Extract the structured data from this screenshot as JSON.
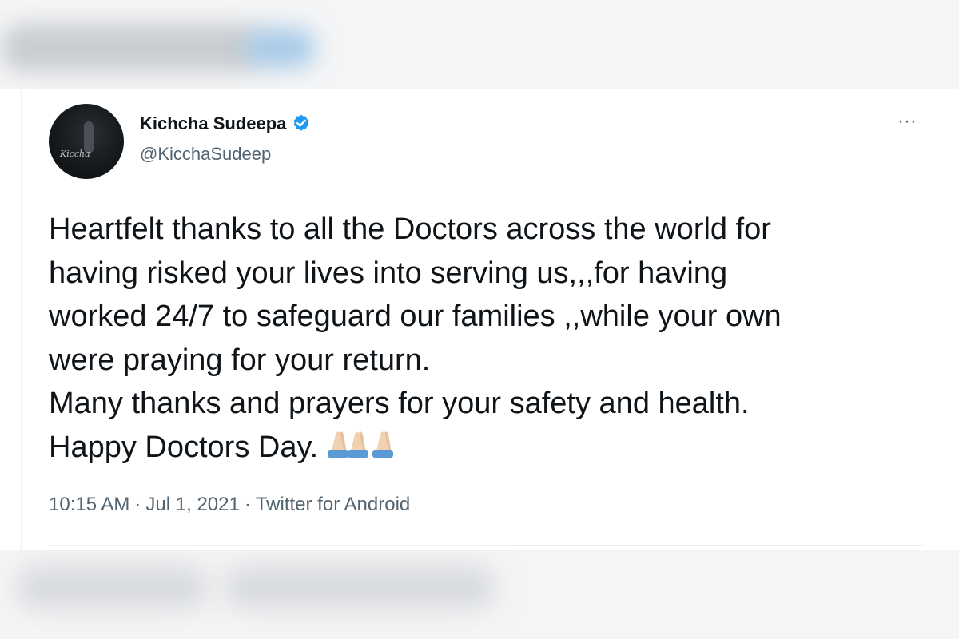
{
  "tweet": {
    "author": {
      "display_name": "Kichcha Sudeepa",
      "handle": "@KicchaSudeep",
      "verified": true,
      "avatar_signature": "Kiccha"
    },
    "more_label": "···",
    "text": "Heartfelt thanks to all the Doctors across the world for\nhaving risked your lives into serving us,,,for having\nworked 24/7 to safeguard our families ,,while your own\nwere praying for your return.\nMany thanks and prayers for your safety and health.\nHappy Doctors Day.",
    "emoji": [
      "folded-hands-icon",
      "folded-hands-icon"
    ],
    "meta": {
      "time": "10:15 AM",
      "separator": "·",
      "date": "Jul 1, 2021",
      "source": "Twitter for Android"
    }
  },
  "colors": {
    "verified_badge": "#1d9bf0",
    "text_primary": "#0f1419",
    "text_secondary": "#536471"
  }
}
